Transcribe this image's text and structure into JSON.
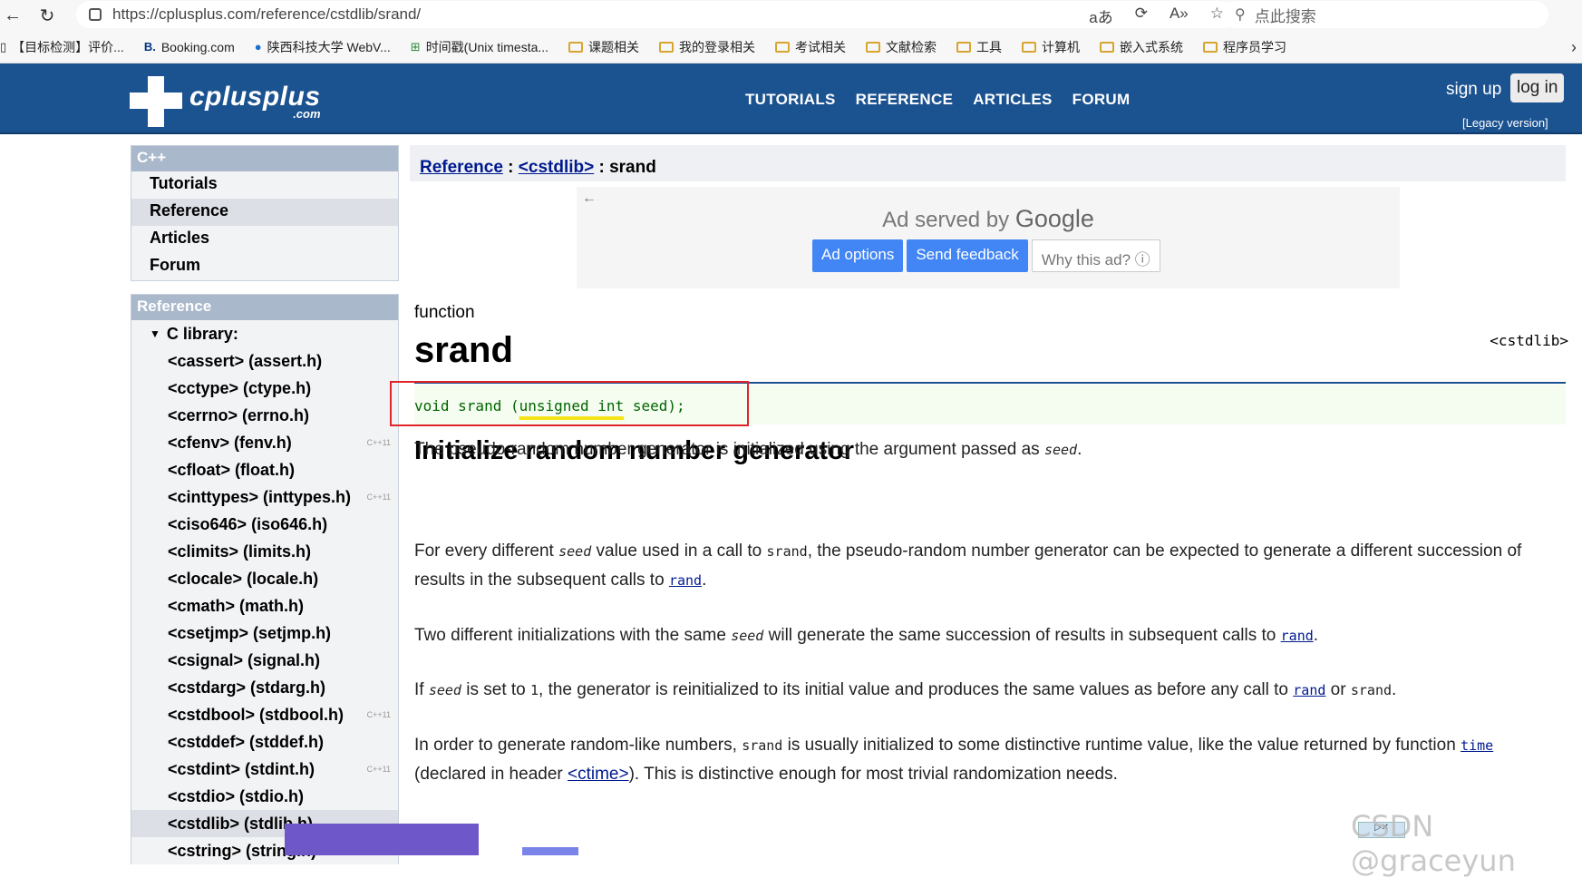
{
  "browser": {
    "url": "https://cplusplus.com/reference/cstdlib/srand/",
    "search_placeholder": "点此搜索",
    "bookmarks": [
      "【目标检测】评价...",
      "Booking.com",
      "陕西科技大学 WebV...",
      "时间戳(Unix timesta...",
      "课题相关",
      "我的登录相关",
      "考试相关",
      "文献检索",
      "工具",
      "计算机",
      "嵌入式系统",
      "程序员学习"
    ]
  },
  "site": {
    "logo_text": "cplusplus",
    "logo_sub": ".com",
    "nav": [
      "TUTORIALS",
      "REFERENCE",
      "ARTICLES",
      "FORUM"
    ],
    "signup": "sign up",
    "login": "log in",
    "legacy": "[Legacy version]"
  },
  "sidebar": {
    "cpp_title": "C++",
    "cpp_items": [
      "Tutorials",
      "Reference",
      "Articles",
      "Forum"
    ],
    "ref_title": "Reference",
    "clib_label": "C library:",
    "libs": [
      {
        "name": "<cassert> (assert.h)",
        "badge": ""
      },
      {
        "name": "<cctype> (ctype.h)",
        "badge": ""
      },
      {
        "name": "<cerrno> (errno.h)",
        "badge": ""
      },
      {
        "name": "<cfenv> (fenv.h)",
        "badge": "C++11"
      },
      {
        "name": "<cfloat> (float.h)",
        "badge": ""
      },
      {
        "name": "<cinttypes> (inttypes.h)",
        "badge": "C++11"
      },
      {
        "name": "<ciso646> (iso646.h)",
        "badge": ""
      },
      {
        "name": "<climits> (limits.h)",
        "badge": ""
      },
      {
        "name": "<clocale> (locale.h)",
        "badge": ""
      },
      {
        "name": "<cmath> (math.h)",
        "badge": ""
      },
      {
        "name": "<csetjmp> (setjmp.h)",
        "badge": ""
      },
      {
        "name": "<csignal> (signal.h)",
        "badge": ""
      },
      {
        "name": "<cstdarg> (stdarg.h)",
        "badge": ""
      },
      {
        "name": "<cstdbool> (stdbool.h)",
        "badge": "C++11"
      },
      {
        "name": "<cstddef> (stddef.h)",
        "badge": ""
      },
      {
        "name": "<cstdint> (stdint.h)",
        "badge": "C++11"
      },
      {
        "name": "<cstdio> (stdio.h)",
        "badge": ""
      },
      {
        "name": "<cstdlib> (stdlib.h)",
        "badge": ""
      },
      {
        "name": "<cstring> (string.h)",
        "badge": ""
      }
    ]
  },
  "main": {
    "crumb_reference": "Reference",
    "crumb_sep1": " : ",
    "crumb_header": "<cstdlib>",
    "crumb_sep2": " : ",
    "crumb_current": "srand",
    "ad_served_prefix": "Ad served by ",
    "ad_served_brand": "Google",
    "ad_options": "Ad options",
    "ad_feedback": "Send feedback",
    "ad_why": "Why this ad? ⓘ",
    "kind": "function",
    "name": "srand",
    "header_tag": "<cstdlib>",
    "proto_pre": "void srand (",
    "proto_hl": "unsigned int",
    "proto_post": " seed);",
    "subtitle": "Initialize random number generator",
    "p1_a": "The pseudo-random number generator is initialized using the argument passed as ",
    "p1_seed": "seed",
    "p1_b": ".",
    "p2_a": "For every different ",
    "p2_seed": "seed",
    "p2_b": " value used in a call to ",
    "p2_srand": "srand",
    "p2_c": ", the pseudo-random number generator can be expected to generate a different succession of results in the subsequent calls to ",
    "p2_rand": "rand",
    "p2_d": ".",
    "p3_a": "Two different initializations with the same ",
    "p3_seed": "seed",
    "p3_b": " will generate the same succession of results in subsequent calls to ",
    "p3_rand": "rand",
    "p3_c": ".",
    "p4_a": "If ",
    "p4_seed": "seed",
    "p4_b": " is set to ",
    "p4_one": "1",
    "p4_c": ", the generator is reinitialized to its initial value and produces the same values as before any call to ",
    "p4_rand": "rand",
    "p4_d": " or ",
    "p4_srand": "srand",
    "p4_e": ".",
    "p5_a": "In order to generate random-like numbers, ",
    "p5_srand": "srand",
    "p5_b": " is usually initialized to some distinctive runtime value, like the value returned by function ",
    "p5_time": "time",
    "p5_c": " (declared in header ",
    "p5_ctime": "<ctime>",
    "p5_d": "). This is distinctive enough for most trivial randomization needs."
  },
  "watermark": "CSDN @graceyun"
}
